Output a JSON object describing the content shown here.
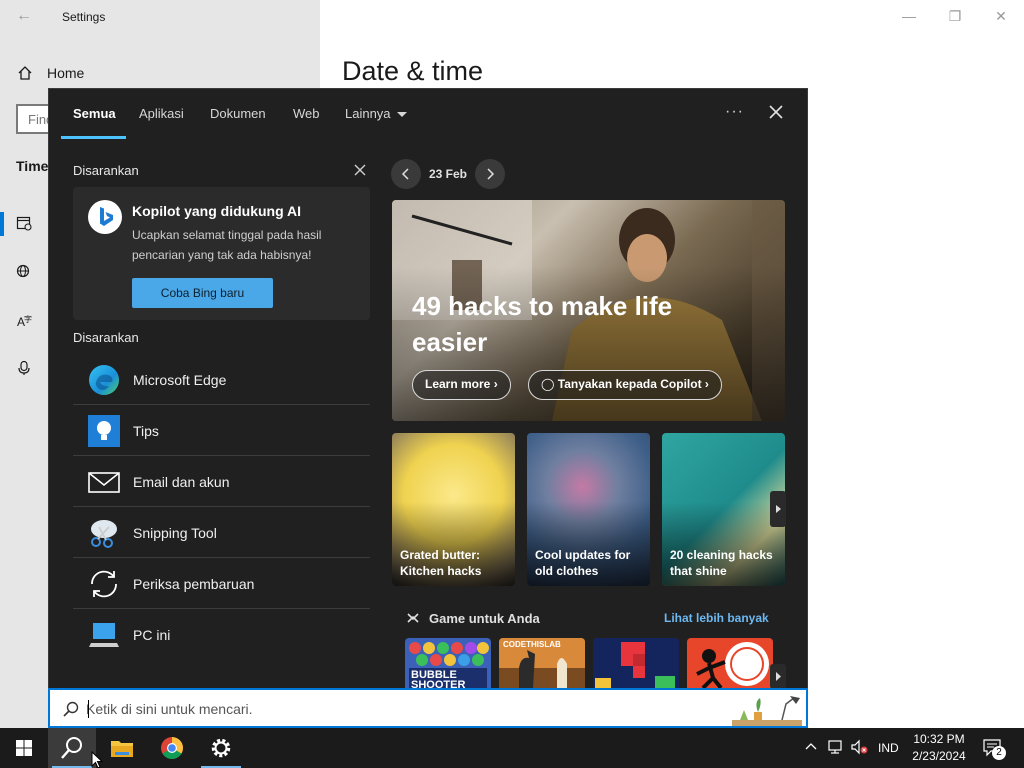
{
  "settings": {
    "window_title": "Settings",
    "home_label": "Home",
    "find_placeholder": "Find a setting",
    "section_title": "Time & Language",
    "page_heading": "Date & time"
  },
  "search": {
    "tabs": [
      {
        "label": "Semua",
        "active": true
      },
      {
        "label": "Aplikasi"
      },
      {
        "label": "Dokumen"
      },
      {
        "label": "Web"
      },
      {
        "label": "Lainnya"
      }
    ],
    "suggested_label_1": "Disarankan",
    "copilot_card": {
      "title": "Kopilot yang didukung AI",
      "description": "Ucapkan selamat tinggal pada hasil pencarian yang tak ada habisnya!",
      "button_label": "Coba Bing baru"
    },
    "suggested_label_2": "Disarankan",
    "apps": [
      {
        "label": "Microsoft Edge",
        "icon": "edge-icon"
      },
      {
        "label": "Tips",
        "icon": "tips-icon"
      },
      {
        "label": "Email dan akun",
        "icon": "mail-icon"
      },
      {
        "label": "Snipping Tool",
        "icon": "snipping-tool-icon"
      },
      {
        "label": "Periksa pembaruan",
        "icon": "refresh-icon"
      },
      {
        "label": "PC ini",
        "icon": "pc-icon"
      }
    ],
    "date_label": "23 Feb",
    "hero": {
      "title": "49 hacks to make life easier",
      "learn_more": "Learn more",
      "ask_copilot": "Tanyakan kepada Copilot"
    },
    "tiles": [
      {
        "label": "Grated butter: Kitchen hacks"
      },
      {
        "label": "Cool updates for old clothes"
      },
      {
        "label": "20 cleaning hacks that shine"
      }
    ],
    "games_header": "Game untuk Anda",
    "games_more": "Lihat lebih banyak",
    "games": [
      {
        "name": "Bubble Shooter HD",
        "label": "BUBBLE SHOOTER"
      },
      {
        "name": "Chess",
        "label": "CODETHISLAB"
      },
      {
        "name": "Block puzzle",
        "label": ""
      },
      {
        "name": "Stickman game",
        "label": ""
      }
    ],
    "searchbox_placeholder": "Ketik di sini untuk mencari."
  },
  "taskbar": {
    "language": "IND",
    "time": "10:32 PM",
    "date": "2/23/2024",
    "notification_count": "2"
  },
  "colors": {
    "accent": "#4cc2ff",
    "panel_bg": "#202020",
    "bing_button": "#4aa8e8",
    "link": "#6cb8f0"
  }
}
